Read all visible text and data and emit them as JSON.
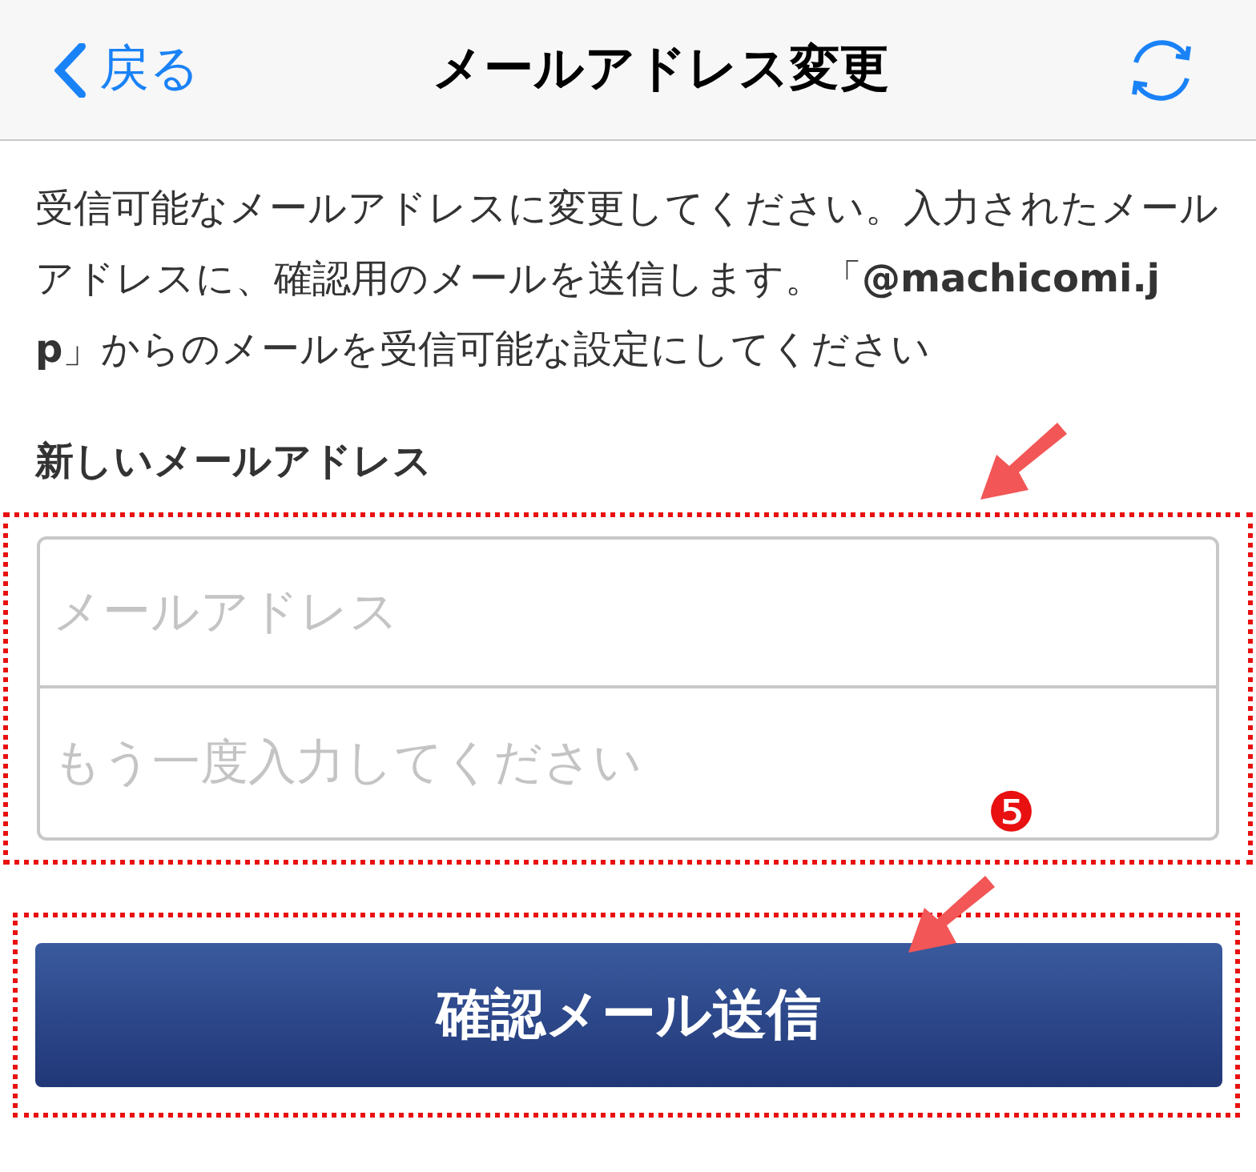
{
  "nav": {
    "back": "戻る",
    "title": "メールアドレス変更"
  },
  "description": "受信可能なメールアドレスに変更してください。入力されたメールアドレスに、確認用のメールを送信します。「**@machicomi.jp**」からのメールを受信可能な設定にしてください",
  "form": {
    "label": "新しいメールアドレス",
    "fields": [
      {
        "placeholder": "メールアドレス"
      },
      {
        "placeholder": "もう一度入力してください"
      }
    ],
    "submit": "確認メール送信"
  },
  "annotation": {
    "step": "❺"
  }
}
